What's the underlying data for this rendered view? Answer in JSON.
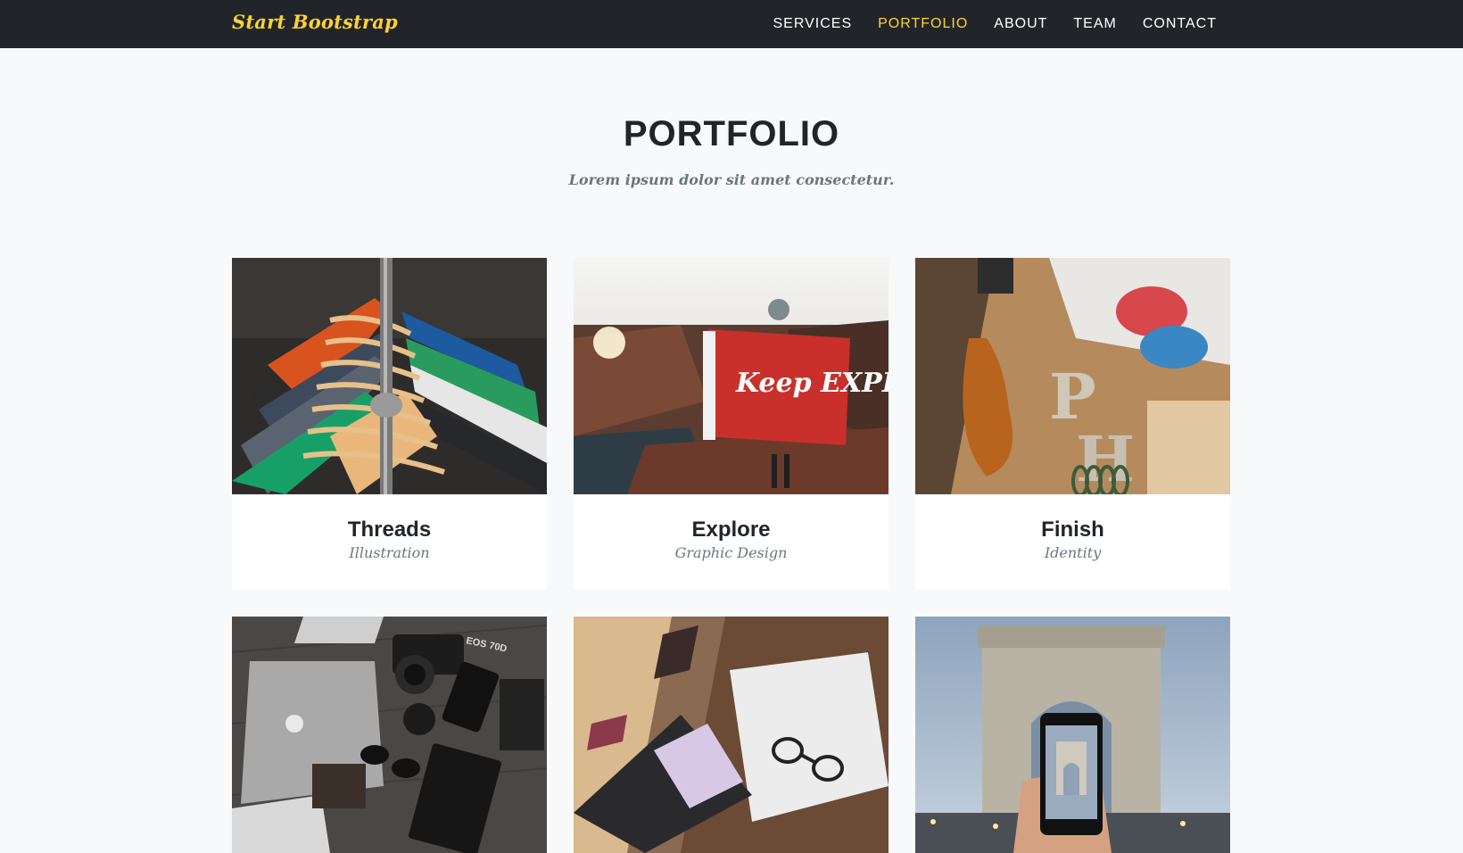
{
  "nav": {
    "brand": "Start Bootstrap",
    "links": [
      {
        "label": "SERVICES",
        "active": false
      },
      {
        "label": "PORTFOLIO",
        "active": true
      },
      {
        "label": "ABOUT",
        "active": false
      },
      {
        "label": "TEAM",
        "active": false
      },
      {
        "label": "CONTACT",
        "active": false
      }
    ]
  },
  "portfolio": {
    "heading": "PORTFOLIO",
    "subheading": "Lorem ipsum dolor sit amet consectetur.",
    "items": [
      {
        "title": "Threads",
        "category": "Illustration",
        "image": "clothes-rack-photo"
      },
      {
        "title": "Explore",
        "category": "Graphic Design",
        "image": "keep-exploring-flag-photo",
        "image_text": "Keep EXPLORING"
      },
      {
        "title": "Finish",
        "category": "Identity",
        "image": "workshop-tools-photo"
      },
      {
        "image": "laptop-camera-flatlay-photo",
        "image_text": "EOS 70D"
      },
      {
        "image": "desk-laptop-glasses-photo"
      },
      {
        "image": "arc-de-triomphe-phone-photo"
      }
    ]
  },
  "colors": {
    "navbar_bg": "#212529",
    "accent": "#fed136",
    "page_bg": "#f8f9fa",
    "heading": "#212529",
    "muted": "#6c757d"
  }
}
